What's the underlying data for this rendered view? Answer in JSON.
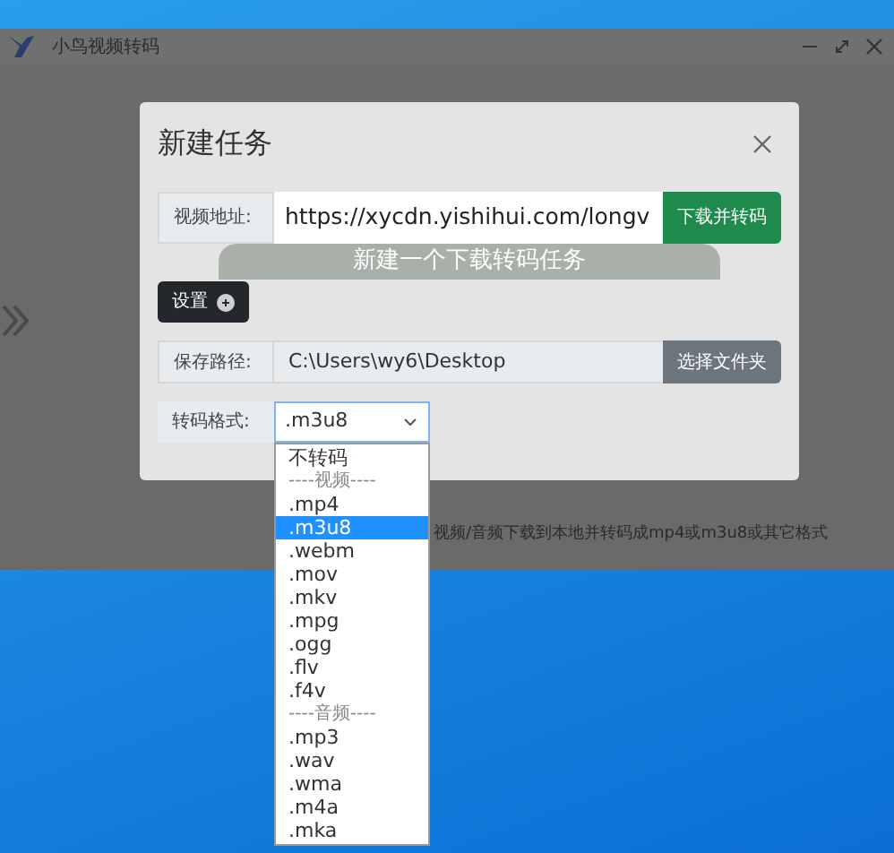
{
  "window": {
    "title": "小鸟视频转码"
  },
  "background_button": {
    "label": "新建一个下载转码任务"
  },
  "hint": "视频/音频下载到本地并转码成mp4或m3u8或其它格式",
  "dialog": {
    "title": "新建任务",
    "url_row": {
      "label": "视频地址:",
      "value": "https://xycdn.yishihui.com/longv",
      "button": "下载并转码"
    },
    "settings_button": "设置",
    "path_row": {
      "label": "保存路径:",
      "value": "C:\\Users\\wy6\\Desktop",
      "button": "选择文件夹"
    },
    "format_row": {
      "label": "转码格式:",
      "value": ".m3u8"
    }
  },
  "dropdown": [
    {
      "kind": "option",
      "label": "不转码",
      "selected": false
    },
    {
      "kind": "header",
      "label": "----视频----"
    },
    {
      "kind": "option",
      "label": ".mp4",
      "selected": false
    },
    {
      "kind": "option",
      "label": ".m3u8",
      "selected": true
    },
    {
      "kind": "option",
      "label": ".webm",
      "selected": false
    },
    {
      "kind": "option",
      "label": ".mov",
      "selected": false
    },
    {
      "kind": "option",
      "label": ".mkv",
      "selected": false
    },
    {
      "kind": "option",
      "label": ".mpg",
      "selected": false
    },
    {
      "kind": "option",
      "label": ".ogg",
      "selected": false
    },
    {
      "kind": "option",
      "label": ".flv",
      "selected": false
    },
    {
      "kind": "option",
      "label": ".f4v",
      "selected": false
    },
    {
      "kind": "header",
      "label": "----音频----"
    },
    {
      "kind": "option",
      "label": ".mp3",
      "selected": false
    },
    {
      "kind": "option",
      "label": ".wav",
      "selected": false
    },
    {
      "kind": "option",
      "label": ".wma",
      "selected": false
    },
    {
      "kind": "option",
      "label": ".m4a",
      "selected": false
    },
    {
      "kind": "option",
      "label": ".mka",
      "selected": false
    }
  ]
}
